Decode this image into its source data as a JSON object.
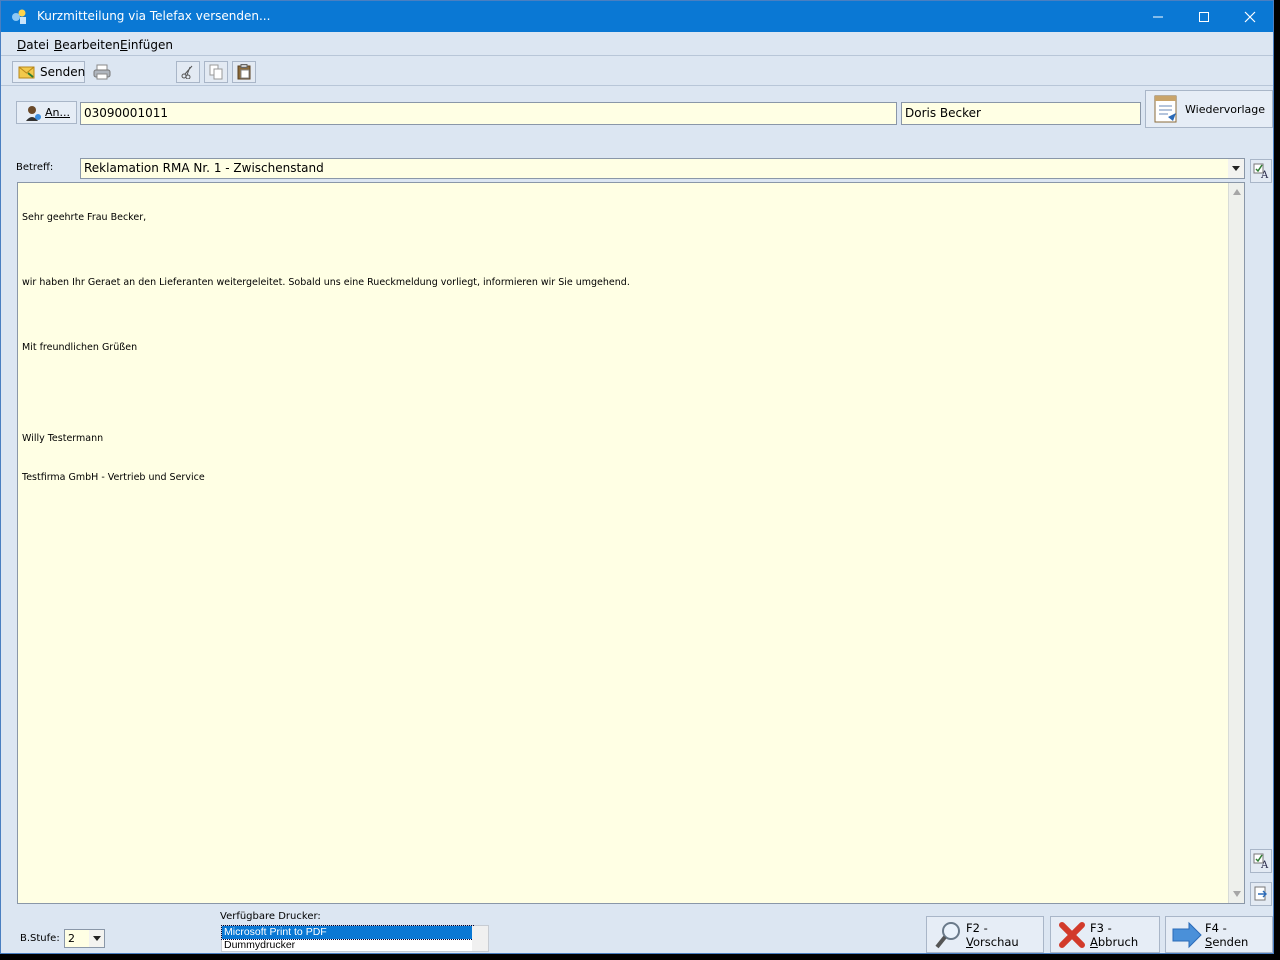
{
  "window": {
    "title": "Kurzmitteilung via Telefax versenden..."
  },
  "menu": [
    {
      "key": "D",
      "rest": "atei"
    },
    {
      "key": "B",
      "rest": "earbeiten"
    },
    {
      "key": "E",
      "rest": "infügen"
    }
  ],
  "toolbar": {
    "send_label": "Senden"
  },
  "recipient": {
    "an_button": "An...",
    "fax_number": "03090001011",
    "name": "Doris Becker",
    "wiedervorlage": "Wiedervorlage"
  },
  "subject": {
    "label": "Betreff:",
    "value": "Reklamation RMA Nr. 1 - Zwischenstand"
  },
  "body": {
    "lines": [
      "Sehr geehrte Frau Becker,",
      "",
      "wir haben Ihr Geraet an den Lieferanten weitergeleitet. Sobald uns eine Rueckmeldung vorliegt, informieren wir Sie umgehend.",
      "",
      "Mit freundlichen Grüßen",
      "",
      "",
      "Willy Testermann",
      "Testfirma GmbH - Vertrieb und Service"
    ]
  },
  "footer": {
    "bstufe_label": "B.Stufe:",
    "bstufe_value": "2",
    "printers_label": "Verfügbare Drucker:",
    "printers": [
      "Microsoft Print to PDF",
      "Dummydrucker"
    ],
    "selected_printer": "Microsoft Print to PDF",
    "preview": {
      "key": "F2 - ",
      "u": "V",
      "rest": "orschau"
    },
    "cancel": {
      "key": "F3 - ",
      "u": "A",
      "rest": "bbruch"
    },
    "send": {
      "key": "F4 - ",
      "u": "S",
      "rest": "enden"
    }
  }
}
